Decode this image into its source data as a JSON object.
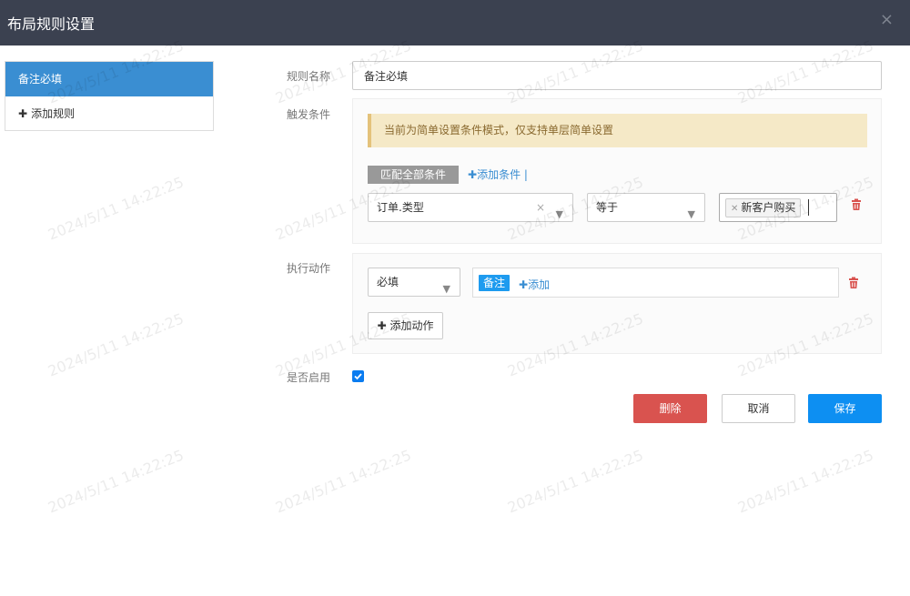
{
  "header": {
    "title": "布局规则设置",
    "close_label": "×"
  },
  "sidebar": {
    "rules": [
      {
        "label": "备注必填",
        "active": true
      }
    ],
    "add_rule_label": "添加规则"
  },
  "form": {
    "name_label": "规则名称",
    "name_value": "备注必填",
    "trigger_label": "触发条件",
    "notice": "当前为简单设置条件模式，仅支持单层简单设置",
    "match_all_label": "匹配全部条件",
    "add_condition_label": "添加条件 |",
    "condition": {
      "field": "订单.类型",
      "operator": "等于",
      "value_tag": "新客户购买"
    },
    "action_label": "执行动作",
    "action": {
      "type": "必填",
      "field_tag": "备注",
      "add_label": "添加"
    },
    "add_action_label": "添加动作",
    "enabled_label": "是否启用",
    "enabled": true
  },
  "buttons": {
    "delete": "删除",
    "cancel": "取消",
    "save": "保存"
  },
  "watermark": "2024/5/11 14:22:25",
  "colors": {
    "header_bg": "#3b4150",
    "active_rule": "#3a8ed2",
    "notice_bg": "#f5e9c7",
    "delete": "#d9534f",
    "save": "#0d8ff2",
    "tag": "#1e9bef"
  }
}
